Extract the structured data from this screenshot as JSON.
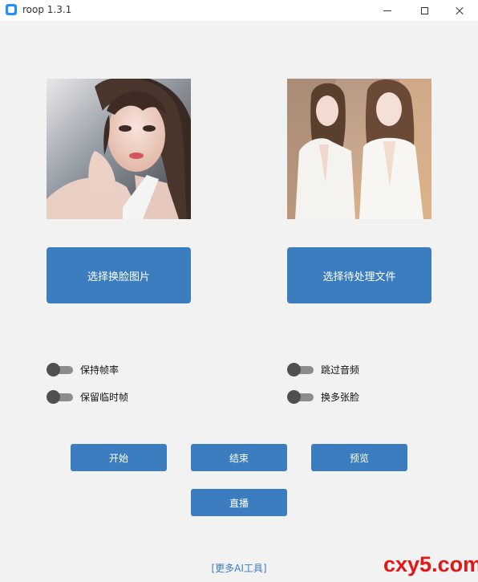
{
  "window": {
    "title": "roop 1.3.1"
  },
  "images": {
    "source_icon": "portrait-photo",
    "target_icon": "two-people-photo"
  },
  "buttons": {
    "select_face": "选择换脸图片",
    "select_target": "选择待处理文件",
    "start": "开始",
    "stop": "结束",
    "preview": "预览",
    "live": "直播"
  },
  "toggles": {
    "keep_fps": {
      "label": "保持帧率",
      "checked": false
    },
    "keep_frames": {
      "label": "保留临时帧",
      "checked": false
    },
    "skip_audio": {
      "label": "跳过音频",
      "checked": false
    },
    "many_faces": {
      "label": "换多张脸",
      "checked": false
    }
  },
  "footer": {
    "more_tools": "[更多AI工具]"
  },
  "watermark": "cxy5.com",
  "colors": {
    "accent": "#3b7dbf",
    "background": "#f2f2f2",
    "switch_track": "#8c8c8c",
    "switch_knob": "#505050",
    "watermark": "#e01818"
  }
}
